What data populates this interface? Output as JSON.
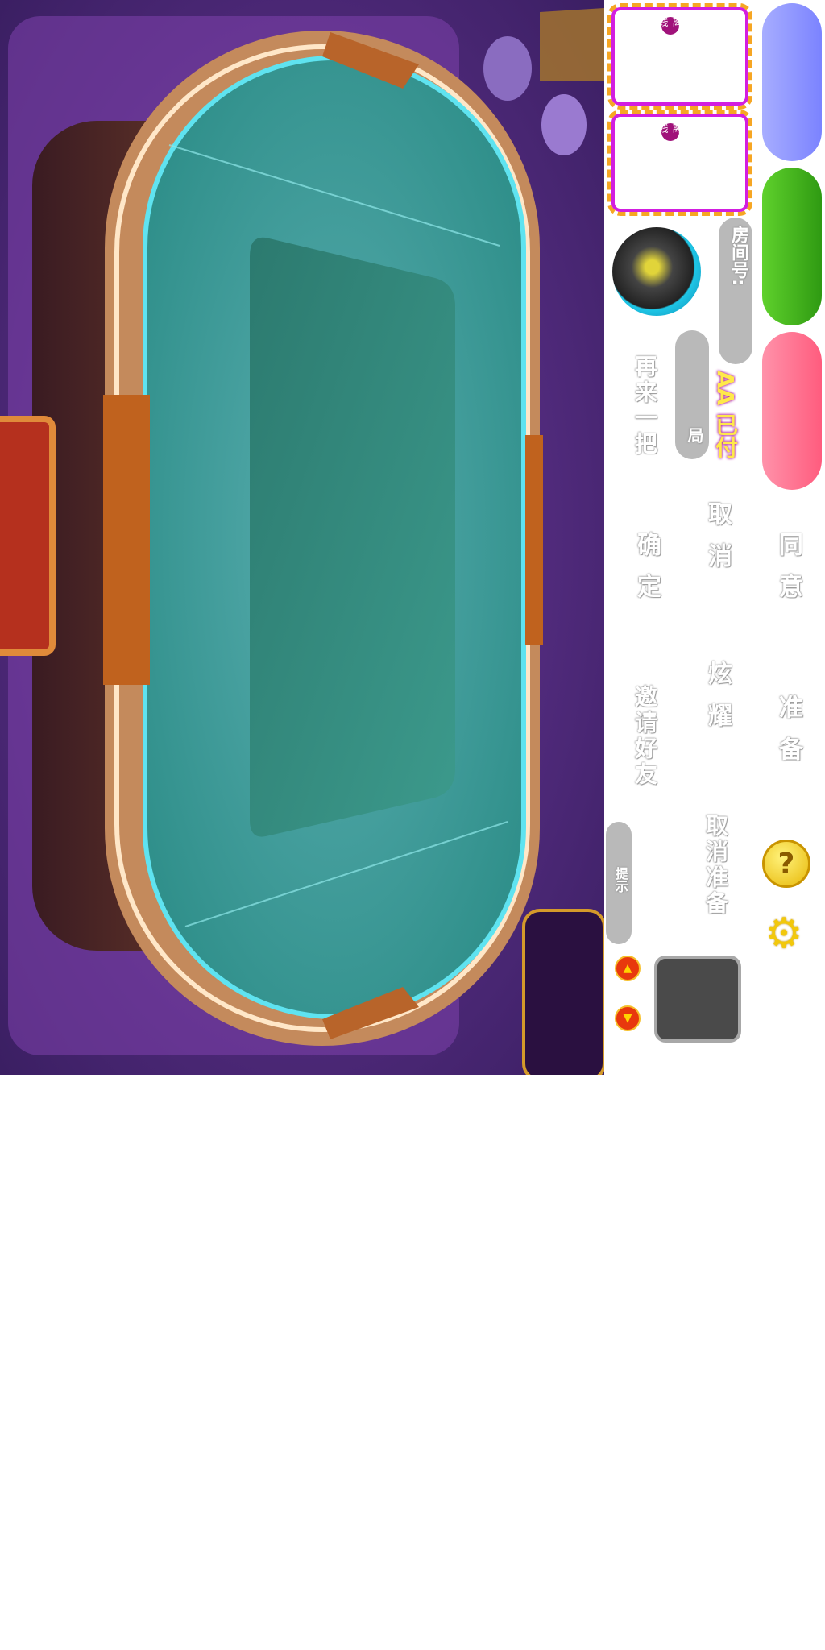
{
  "table": {
    "felt_color": "#2e8f86",
    "rim_color": "#5fe3f0",
    "frame_color": "#c47a3a"
  },
  "buttons": {
    "blue_color": "#8b93ff",
    "green_color": "#3aa01a",
    "red_color": "#ff6d8a"
  },
  "labels": {
    "agree": "同意",
    "ready": "准备",
    "cancel": "取消",
    "show_off": "炫耀",
    "cancel_ready": "取消准备",
    "confirm": "确定",
    "invite_friends": "邀请好友",
    "play_again": "再来一把",
    "room_no": "房间号:",
    "aa_paid": "AA 已付",
    "round": "局",
    "hint": "提示"
  },
  "badges": {
    "top": "离线",
    "bottom": "离线"
  },
  "icons": [
    "clock-icon",
    "help-icon",
    "settings-icon",
    "arrow-up-icon",
    "arrow-down-icon"
  ]
}
